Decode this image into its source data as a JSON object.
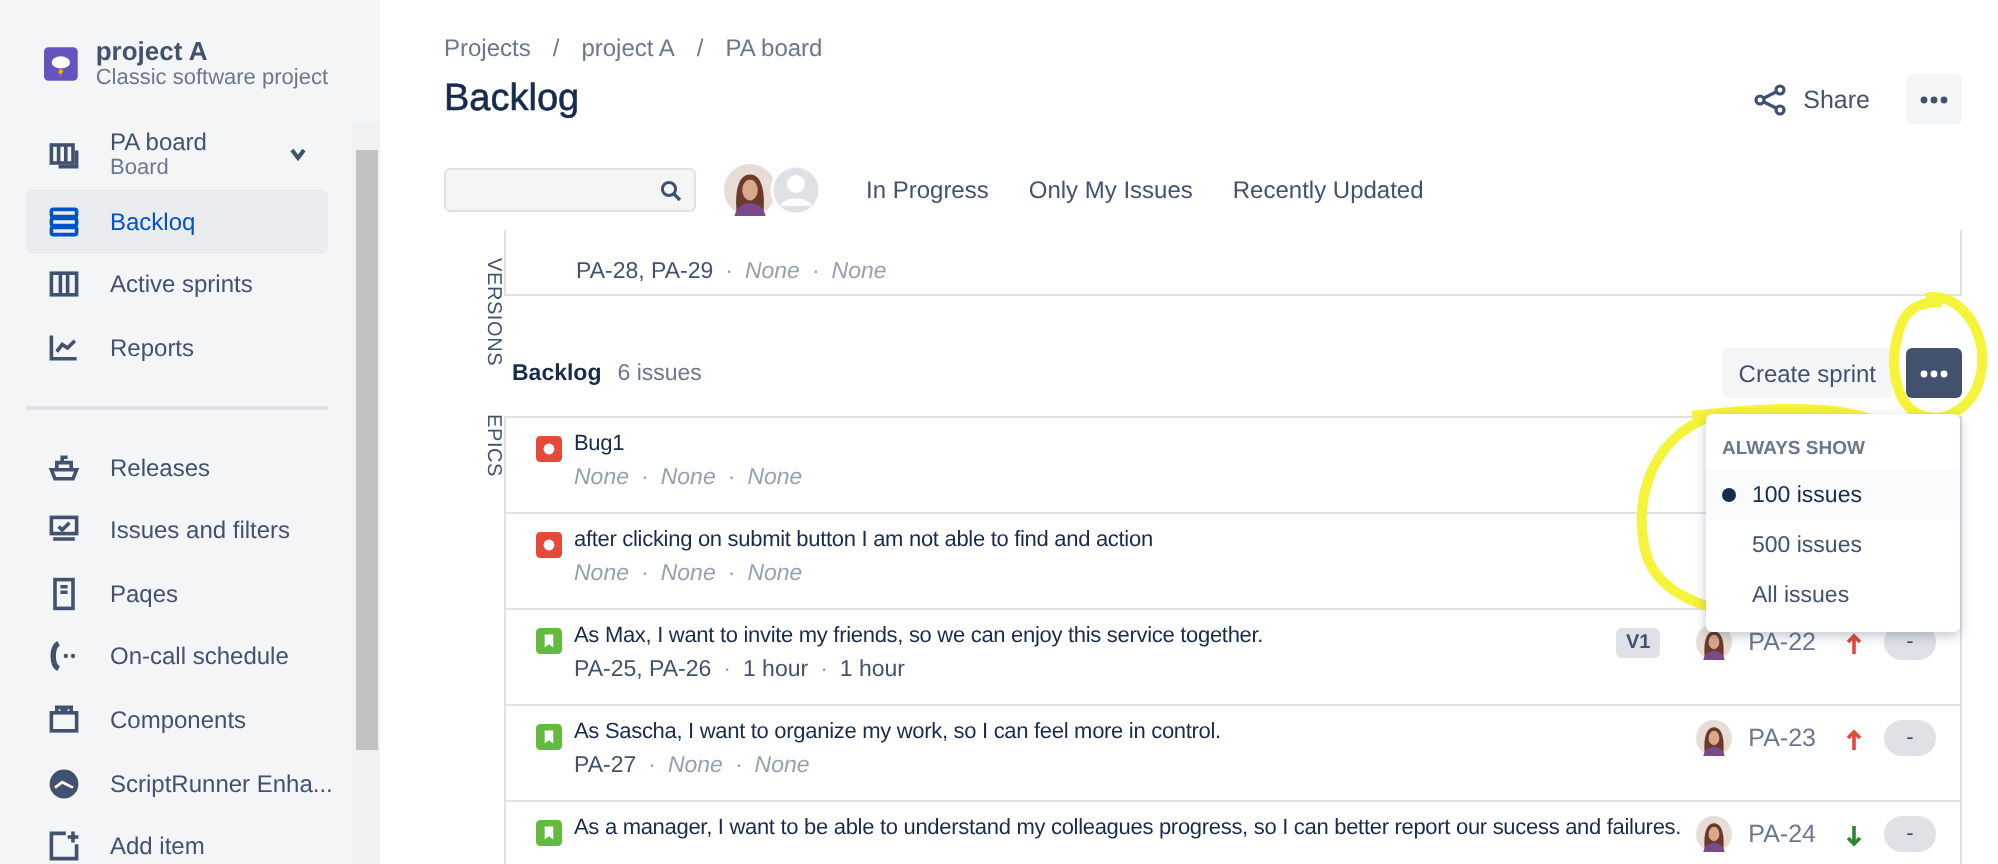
{
  "project": {
    "name": "project A",
    "type": "Classic software project"
  },
  "sidebar": {
    "main_items": [
      {
        "label": "PA board",
        "sublabel": "Board",
        "expanded": false,
        "selected": false
      },
      {
        "label": "Backloq",
        "selected": true
      },
      {
        "label": "Active sprints",
        "selected": false
      },
      {
        "label": "Reports",
        "selected": false
      }
    ],
    "project_items": [
      {
        "label": "Releases",
        "selected": false
      },
      {
        "label": "Issues and filters",
        "selected": false
      },
      {
        "label": "Paqes",
        "selected": false
      },
      {
        "label": "On-call schedule",
        "selected": false
      },
      {
        "label": "Components",
        "selected": false
      },
      {
        "label": "ScriptRunner Enha...",
        "selected": false
      },
      {
        "label": "Add item",
        "selected": false
      }
    ]
  },
  "breadcrumb_separator": "/",
  "meta_separator": "·",
  "breadcrumbs": [
    "Projects",
    "project A",
    "PA board"
  ],
  "title": "Backlog",
  "share": "Share",
  "quick_filters": [
    "In Progress",
    "Only My Issues",
    "Recently Updated"
  ],
  "side_tabs": [
    "VERSIONS",
    "EPICS"
  ],
  "sprint_preview": {
    "meta": [
      {
        "text": "PA-28, PA-29",
        "empty": false
      },
      {
        "text": "None",
        "empty": true
      },
      {
        "text": "None",
        "empty": true
      }
    ]
  },
  "backlog": {
    "title": "Backlog",
    "count": "6 issues",
    "create_sprint": "Create sprint",
    "menu": {
      "heading": "ALWAYS SHOW",
      "options": [
        {
          "label": "100 issues",
          "selected": true
        },
        {
          "label": "500 issues",
          "selected": false
        },
        {
          "label": "All issues",
          "selected": false
        }
      ]
    },
    "issues": [
      {
        "kind": "bug",
        "summary": "Bug1",
        "meta": [
          {
            "text": "None",
            "empty": true
          },
          {
            "text": "None",
            "empty": true
          },
          {
            "text": "None",
            "empty": true
          }
        ]
      },
      {
        "kind": "bug",
        "summary": "after clicking on submit button I am not able to find and action",
        "meta": [
          {
            "text": "None",
            "empty": true
          },
          {
            "text": "None",
            "empty": true
          },
          {
            "text": "None",
            "empty": true
          }
        ]
      },
      {
        "kind": "story",
        "summary": "As Max, I want to invite my friends, so we can enjoy this service together.",
        "meta": [
          {
            "text": "PA-25, PA-26",
            "empty": false
          },
          {
            "text": "1 hour",
            "empty": false
          },
          {
            "text": "1 hour",
            "empty": false
          }
        ],
        "version": "V1",
        "key": "PA-22",
        "high_priority": true,
        "estimate": "-"
      },
      {
        "kind": "story",
        "summary": "As Sascha, I want to organize my work, so I can feel more in control.",
        "meta": [
          {
            "text": "PA-27",
            "empty": false
          },
          {
            "text": "None",
            "empty": true
          },
          {
            "text": "None",
            "empty": true
          }
        ],
        "key": "PA-23",
        "high_priority": true,
        "estimate": "-"
      },
      {
        "kind": "story",
        "summary": "As a manager, I want to be able to understand my colleagues progress, so I can better report our sucess and failures.",
        "key": "PA-24",
        "high_priority": false,
        "estimate": "-"
      }
    ]
  }
}
